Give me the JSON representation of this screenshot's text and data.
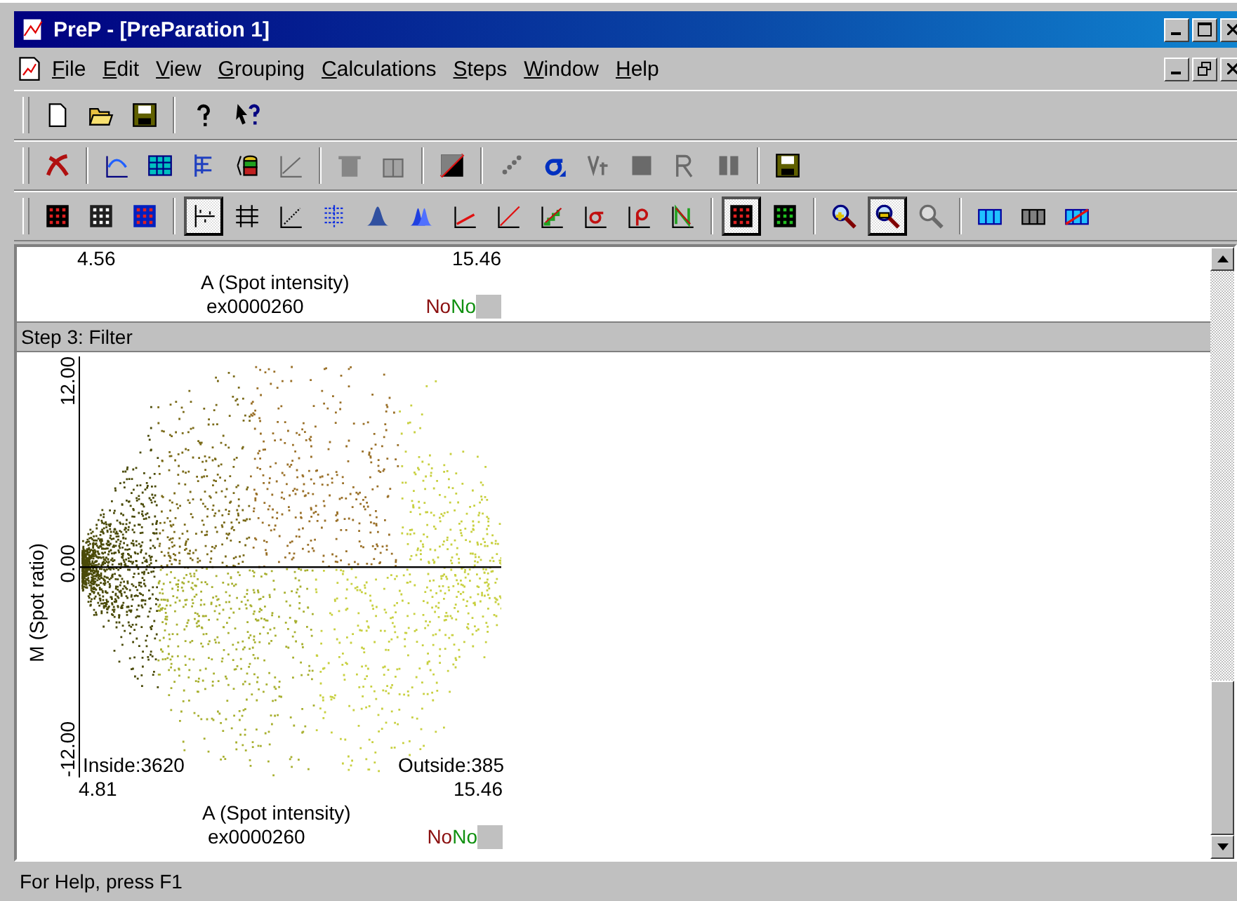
{
  "window": {
    "title": "PreP - [PreParation 1]"
  },
  "menu": [
    "File",
    "Edit",
    "View",
    "Grouping",
    "Calculations",
    "Steps",
    "Window",
    "Help"
  ],
  "toolbars": [
    {
      "groups": [
        [
          {
            "pressed": false,
            "disabled": false
          },
          {
            "pressed": false,
            "disabled": false
          },
          {
            "pressed": false,
            "disabled": false
          }
        ],
        [
          {
            "pressed": false,
            "disabled": false
          },
          {
            "pressed": false,
            "disabled": false
          }
        ]
      ]
    },
    {
      "groups": [
        [
          {
            "pressed": false,
            "disabled": false
          }
        ],
        [
          {
            "pressed": false,
            "disabled": false
          },
          {
            "pressed": false,
            "disabled": false
          },
          {
            "pressed": false,
            "disabled": false
          },
          {
            "pressed": false,
            "disabled": false
          },
          {
            "pressed": false,
            "disabled": true
          }
        ],
        [
          {
            "pressed": false,
            "disabled": true
          },
          {
            "pressed": false,
            "disabled": true
          }
        ],
        [
          {
            "pressed": false,
            "disabled": false
          }
        ],
        [
          {
            "pressed": false,
            "disabled": true
          },
          {
            "pressed": false,
            "disabled": false
          },
          {
            "pressed": false,
            "disabled": true
          },
          {
            "pressed": false,
            "disabled": true
          },
          {
            "pressed": false,
            "disabled": true
          },
          {
            "pressed": false,
            "disabled": true
          }
        ],
        [
          {
            "pressed": false,
            "disabled": false
          }
        ]
      ]
    },
    {
      "groups": [
        [
          {
            "pressed": false,
            "disabled": false
          },
          {
            "pressed": false,
            "disabled": false
          },
          {
            "pressed": false,
            "disabled": false
          }
        ],
        [
          {
            "pressed": true,
            "disabled": false
          },
          {
            "pressed": false,
            "disabled": false
          },
          {
            "pressed": false,
            "disabled": false
          },
          {
            "pressed": false,
            "disabled": false
          },
          {
            "pressed": false,
            "disabled": false
          },
          {
            "pressed": false,
            "disabled": false
          },
          {
            "pressed": false,
            "disabled": false
          },
          {
            "pressed": false,
            "disabled": false
          },
          {
            "pressed": false,
            "disabled": false
          },
          {
            "pressed": false,
            "disabled": false
          },
          {
            "pressed": false,
            "disabled": false
          },
          {
            "pressed": false,
            "disabled": false
          }
        ],
        [
          {
            "pressed": true,
            "disabled": false
          },
          {
            "pressed": false,
            "disabled": false
          }
        ],
        [
          {
            "pressed": false,
            "disabled": false
          },
          {
            "pressed": true,
            "disabled": false
          },
          {
            "pressed": false,
            "disabled": true
          }
        ],
        [
          {
            "pressed": false,
            "disabled": false
          },
          {
            "pressed": false,
            "disabled": false
          },
          {
            "pressed": false,
            "disabled": false
          }
        ]
      ]
    }
  ],
  "top_panel": {
    "x_min": "4.56",
    "x_max": "15.46",
    "x_label": "A (Spot intensity)",
    "sample": "ex0000260",
    "flags": [
      {
        "text": "No",
        "color": "#8b1010"
      },
      {
        "text": "No",
        "color": "#109010"
      }
    ]
  },
  "step": {
    "title": "Step 3: Filter",
    "y_label": "M (Spot ratio)",
    "y_ticks": [
      "12.00",
      "0.00",
      "-12.00"
    ],
    "inside": "Inside:3620",
    "outside": "Outside:385",
    "x_min": "4.81",
    "x_max": "15.46",
    "x_label": "A (Spot intensity)",
    "sample": "ex0000260",
    "flags": [
      {
        "text": "No",
        "color": "#8b1010"
      },
      {
        "text": "No",
        "color": "#109010"
      }
    ]
  },
  "status_bar": "For Help, press F1"
}
